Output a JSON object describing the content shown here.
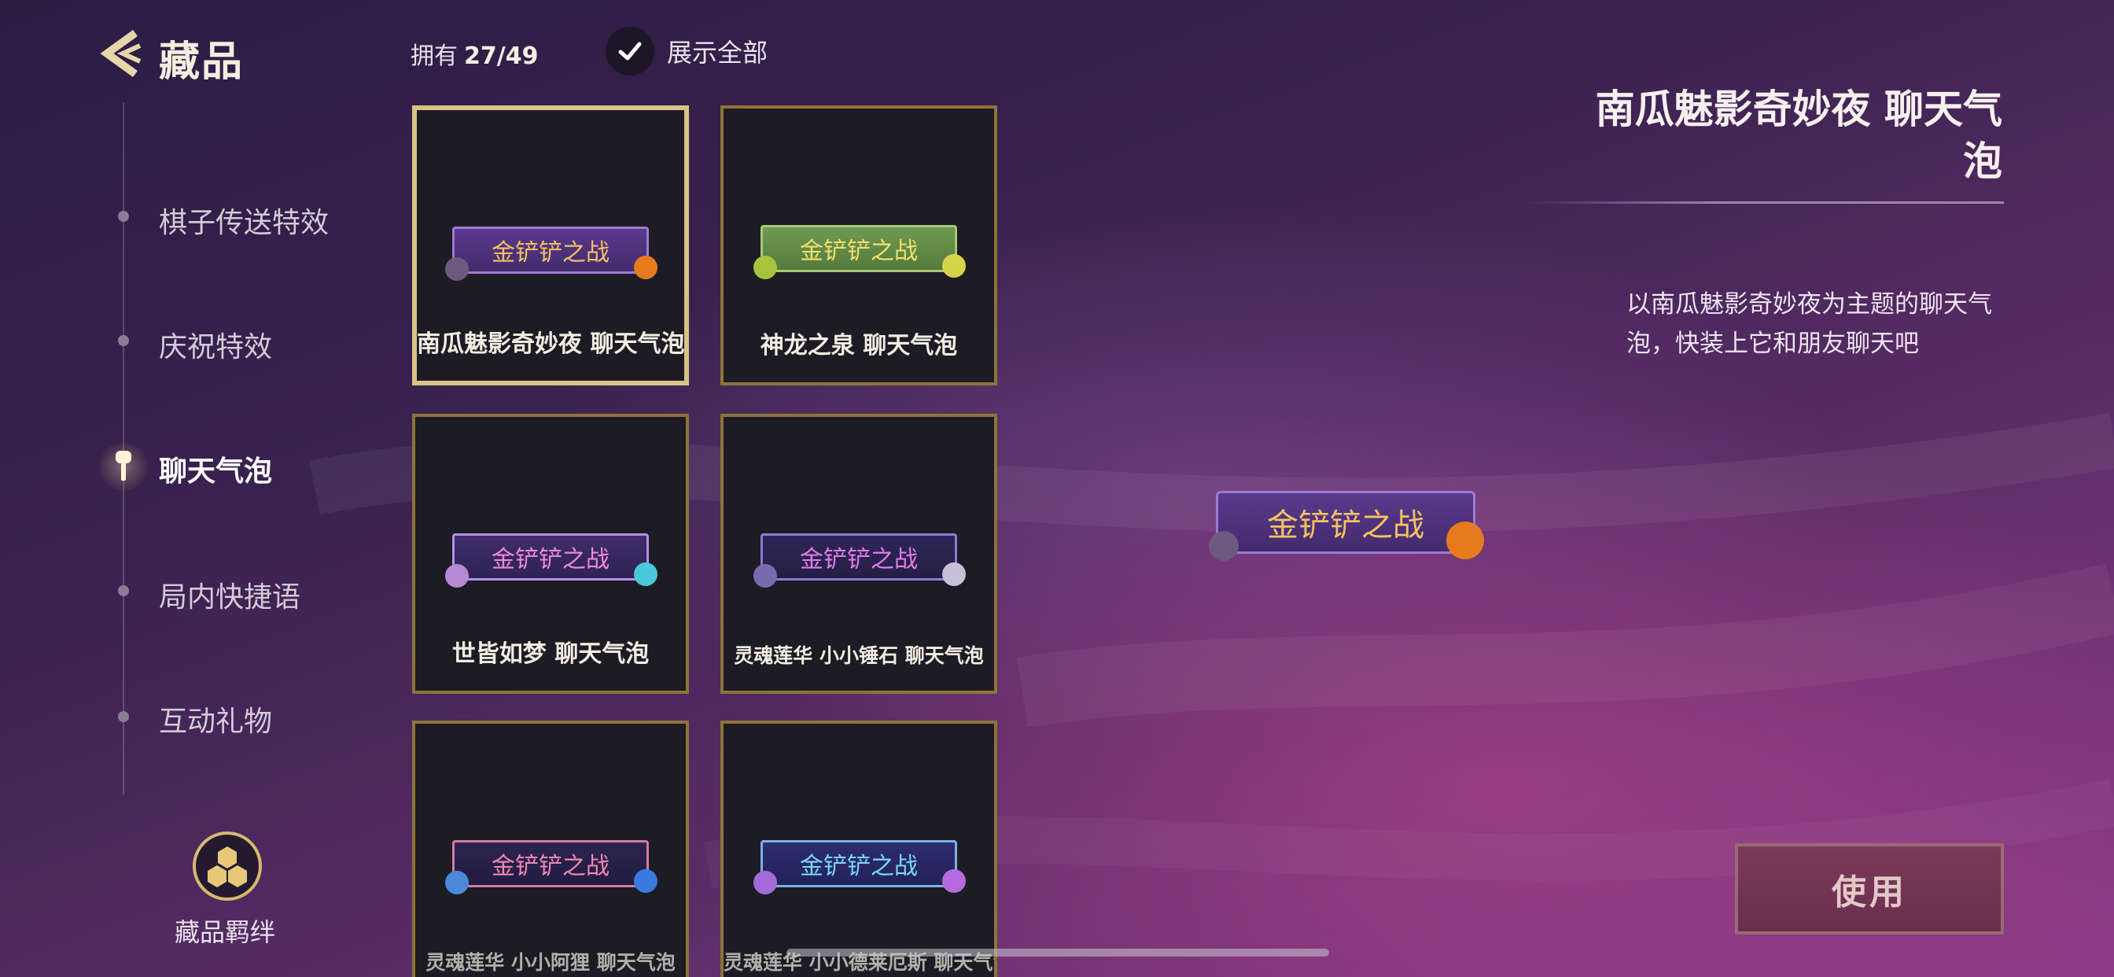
{
  "header": {
    "title": "藏品",
    "owned_label": "拥有",
    "owned_count": "27/49",
    "show_all_label": "展示全部"
  },
  "sidebar": {
    "items": [
      {
        "label": "棋子传送特效"
      },
      {
        "label": "庆祝特效"
      },
      {
        "label": "聊天气泡",
        "active": true
      },
      {
        "label": "局内快捷语"
      },
      {
        "label": "互动礼物"
      }
    ],
    "bond_label": "藏品羁绊"
  },
  "grid": {
    "items": [
      {
        "name": "南瓜魅影奇妙夜  聊天气泡",
        "bubble_text": "金铲铲之战",
        "theme": "pumpkin",
        "selected": true
      },
      {
        "name": "神龙之泉  聊天气泡",
        "bubble_text": "金铲铲之战",
        "theme": "dragon"
      },
      {
        "name": "世皆如梦  聊天气泡",
        "bubble_text": "金铲铲之战",
        "theme": "dream"
      },
      {
        "name": "灵魂莲华  小小锤石  聊天气泡",
        "bubble_text": "金铲铲之战",
        "theme": "soul1"
      },
      {
        "name": "灵魂莲华  小小阿狸  聊天气泡",
        "bubble_text": "金铲铲之战",
        "theme": "soul2"
      },
      {
        "name": "灵魂莲华  小小德莱厄斯  聊天气泡",
        "bubble_text": "金铲铲之战",
        "theme": "soul3"
      }
    ]
  },
  "detail": {
    "title": "南瓜魅影奇妙夜  聊天气泡",
    "description": "以南瓜魅影奇妙夜为主题的聊天气泡，快装上它和朋友聊天吧",
    "preview_text": "金铲铲之战",
    "use_label": "使用"
  },
  "colors": {
    "gold_border": "#8d7436",
    "selected_border": "#d9c386",
    "use_button": "#7a3a5a"
  }
}
